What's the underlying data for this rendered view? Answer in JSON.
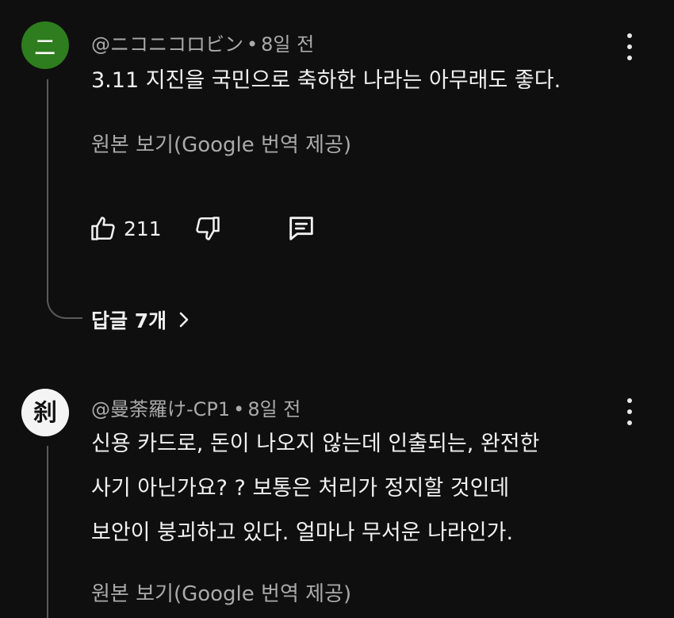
{
  "comments": [
    {
      "avatar_text": "ニ",
      "avatar_color": "#2e7d1e",
      "author": "@ニコニコロビン",
      "time": "8일 전",
      "lines": [
        "3.11 지진을 국민으로 축하한 나라는 아무래도 좋다."
      ],
      "translate_label": "원본 보기(Google 번역 제공)",
      "likes": "211",
      "replies_label": "답글 7개"
    },
    {
      "avatar_text": "刹",
      "author": "@曼荼羅け-CP1",
      "time": "8일 전",
      "lines": [
        "신용 카드로, 돈이 나오지 않는데 인출되는, 완전한",
        "사기 아닌가요? ? 보통은 처리가 정지할 것인데",
        "보안이 붕괴하고 있다. 얼마나 무서운 나라인가."
      ],
      "translate_label": "원본 보기(Google 번역 제공)"
    }
  ],
  "icons": {
    "like": "thumbs-up-icon",
    "dislike": "thumbs-down-icon",
    "reply": "comment-icon",
    "more": "more-vert-icon",
    "chevron": "chevron-right-icon"
  },
  "separator": "•",
  "theme": {
    "background": "#0f0f0f",
    "text": "#f1f1f1",
    "secondary": "#aaaaaa"
  }
}
